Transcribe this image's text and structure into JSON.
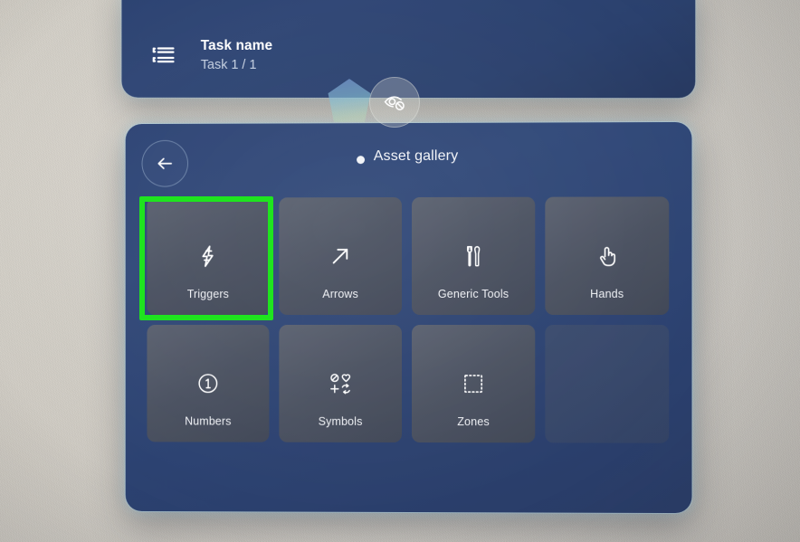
{
  "scene": {
    "background_color": "#d0ccc4",
    "panel_color": "#2d4371",
    "tile_color": "#585d6b",
    "accent_color": "#9ad3ea",
    "selection_color": "#22e322"
  },
  "task_panel": {
    "icon": "task-list-icon",
    "title": "Task name",
    "progress": "Task 1 / 1"
  },
  "floating_controls": {
    "gem_icon": "hologram-gem-icon",
    "eye_off_button": {
      "icon": "eye-off-icon",
      "label": ""
    }
  },
  "gallery": {
    "back_button": {
      "icon": "arrow-left-icon",
      "label": ""
    },
    "title": "Asset gallery",
    "title_dot": true,
    "tiles": [
      {
        "label": "Triggers",
        "icon": "lightning-bolt-icon",
        "selected": true,
        "empty": false
      },
      {
        "label": "Arrows",
        "icon": "arrow-up-right-icon",
        "selected": false,
        "empty": false
      },
      {
        "label": "Generic Tools",
        "icon": "tools-icon",
        "selected": false,
        "empty": false
      },
      {
        "label": "Hands",
        "icon": "pointing-hand-icon",
        "selected": false,
        "empty": false
      },
      {
        "label": "Numbers",
        "icon": "circled-one-icon",
        "selected": false,
        "empty": false
      },
      {
        "label": "Symbols",
        "icon": "symbols-grid-icon",
        "selected": false,
        "empty": false
      },
      {
        "label": "Zones",
        "icon": "dashed-square-icon",
        "selected": false,
        "empty": false
      },
      {
        "label": "",
        "icon": "",
        "selected": false,
        "empty": true
      }
    ]
  }
}
